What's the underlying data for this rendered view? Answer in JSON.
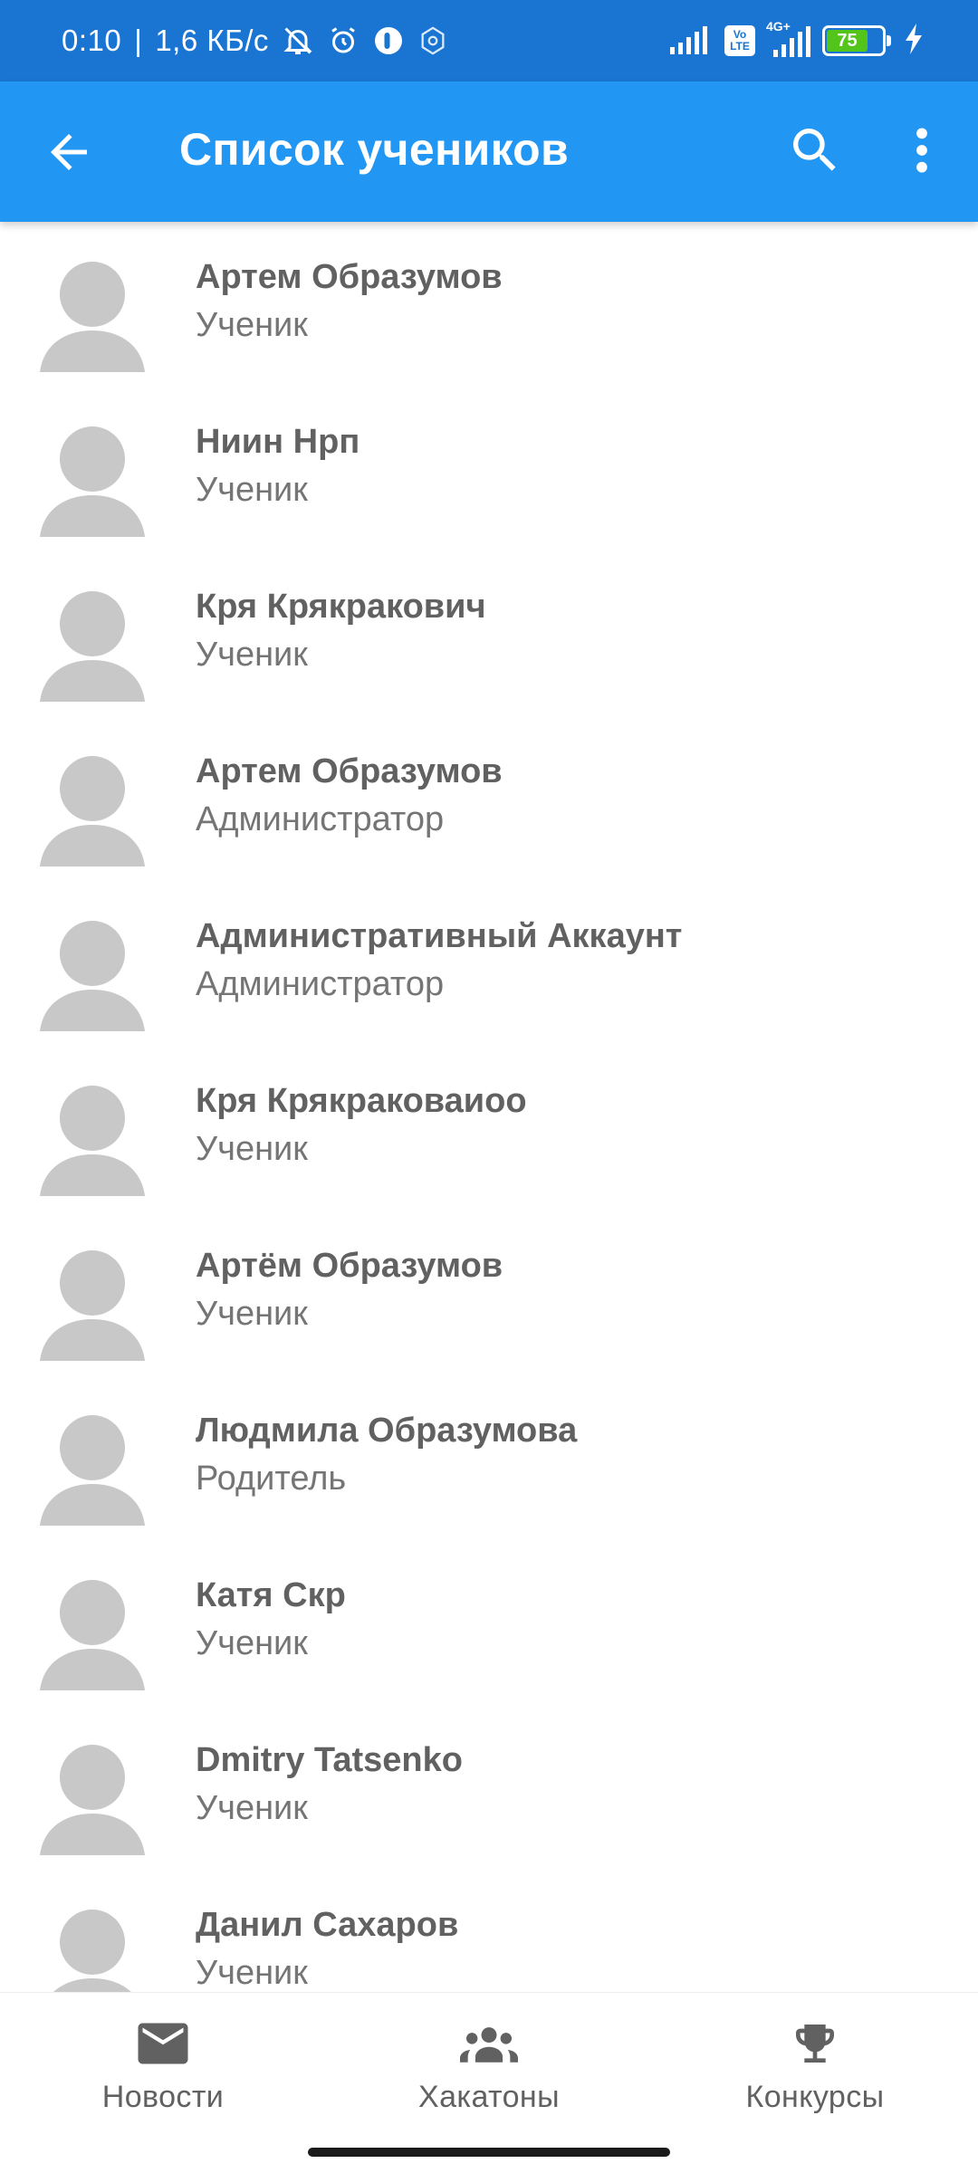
{
  "status_bar": {
    "time": "0:10",
    "separator": "|",
    "speed": "1,6 КБ/с",
    "lte_top": "Vo",
    "lte_bottom": "LTE",
    "network_label": "4G+",
    "battery": "75",
    "battery_level": 0.75,
    "icons": [
      "bell-off-icon",
      "alarm-icon",
      "app-notification-icon",
      "settings-icon",
      "signal-icon",
      "volte-icon",
      "signal-4g-icon",
      "battery-icon",
      "charging-icon"
    ]
  },
  "app_bar": {
    "title": "Список учеников",
    "icons": [
      "back-arrow-icon",
      "search-icon",
      "more-vert-icon"
    ]
  },
  "students": [
    {
      "name": "Артем Образумов",
      "role": "Ученик"
    },
    {
      "name": "Ниин Нрп",
      "role": "Ученик"
    },
    {
      "name": "Кря Крякракович",
      "role": "Ученик"
    },
    {
      "name": "Артем Образумов",
      "role": "Администратор"
    },
    {
      "name": "Административный Аккаунт",
      "role": "Администратор"
    },
    {
      "name": "Кря Крякраковаиоо",
      "role": "Ученик"
    },
    {
      "name": "Артём Образумов",
      "role": "Ученик"
    },
    {
      "name": "Людмила Образумова",
      "role": "Родитель"
    },
    {
      "name": "Катя Скр",
      "role": "Ученик"
    },
    {
      "name": "Dmitry Tatsenko",
      "role": "Ученик"
    },
    {
      "name": "Данил Сахаров",
      "role": "Ученик"
    }
  ],
  "bottom_nav": {
    "items": [
      {
        "label": "Новости",
        "icon": "mail-icon"
      },
      {
        "label": "Хакатоны",
        "icon": "groups-icon"
      },
      {
        "label": "Конкурсы",
        "icon": "trophy-icon"
      }
    ]
  },
  "colors": {
    "status_bar": "#1a75d2",
    "app_bar": "#2196f3",
    "avatar": "#c8c8c8",
    "name_text": "#616161",
    "role_text": "#757575"
  }
}
